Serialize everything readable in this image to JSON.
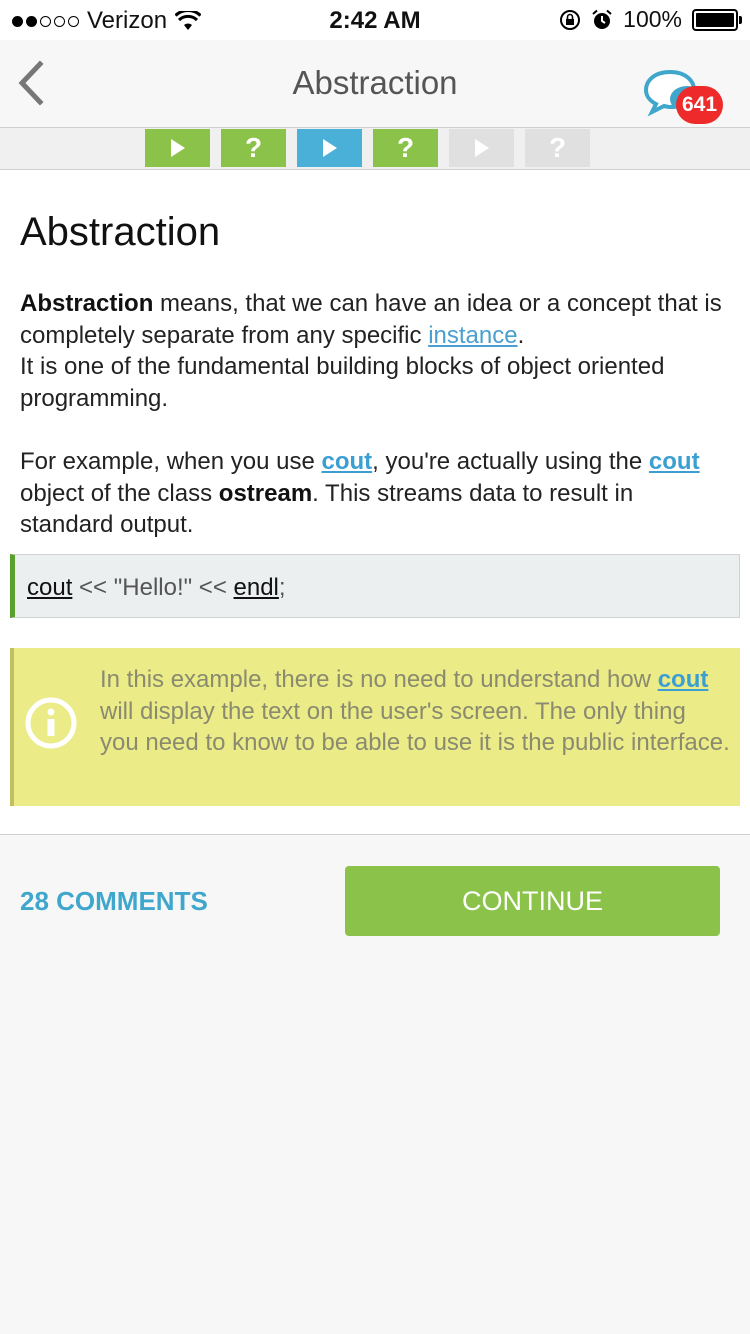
{
  "status_bar": {
    "carrier": "Verizon",
    "signal_bars_filled": 2,
    "signal_bars_total": 5,
    "time": "2:42 AM",
    "battery": "100%",
    "battery_level": 1.0
  },
  "nav": {
    "title": "Abstraction",
    "chat_badge": "641"
  },
  "progress": {
    "steps": [
      {
        "type": "play",
        "state": "done",
        "color": "#8bc34a"
      },
      {
        "type": "quiz",
        "glyph": "?",
        "state": "done",
        "color": "#8bc34a"
      },
      {
        "type": "play",
        "state": "current",
        "color": "#4ab0d8"
      },
      {
        "type": "quiz",
        "glyph": "?",
        "state": "done",
        "color": "#8bc34a"
      },
      {
        "type": "play",
        "state": "locked",
        "color": "#e0e0e0"
      },
      {
        "type": "quiz",
        "glyph": "?",
        "state": "locked",
        "color": "#e0e0e0"
      }
    ]
  },
  "lesson": {
    "heading": "Abstraction",
    "p1": {
      "bold": "Abstraction",
      "text1": " means, that we can have an idea or a concept that is completely separate from any specific ",
      "link": "instance",
      "text2": ".",
      "line2": "It is one of the fundamental building blocks of object oriented programming."
    },
    "p2": {
      "text1": "For example, when you use ",
      "link1": "cout",
      "text2": ", you're actually using the ",
      "link2": "cout",
      "text3": " object of the class ",
      "bold": "ostream",
      "text4": ". This streams data to result in standard output."
    },
    "code": {
      "token1": "cout",
      "mid": " << \"Hello!\" << ",
      "token2": "endl",
      "end": ";"
    },
    "note": {
      "text1": "In this example, there is no need to understand how ",
      "link": "cout",
      "text2": " will display the text on the user's screen. The only thing you need to know to be able to use it is the public interface."
    }
  },
  "actions": {
    "comments": "28 COMMENTS",
    "continue": "CONTINUE"
  },
  "colors": {
    "green": "#8bc34a",
    "blue": "#4ab0d8",
    "link": "#3b9fd2",
    "badge": "#ee2a2a",
    "note_bg": "#ebeb88"
  }
}
